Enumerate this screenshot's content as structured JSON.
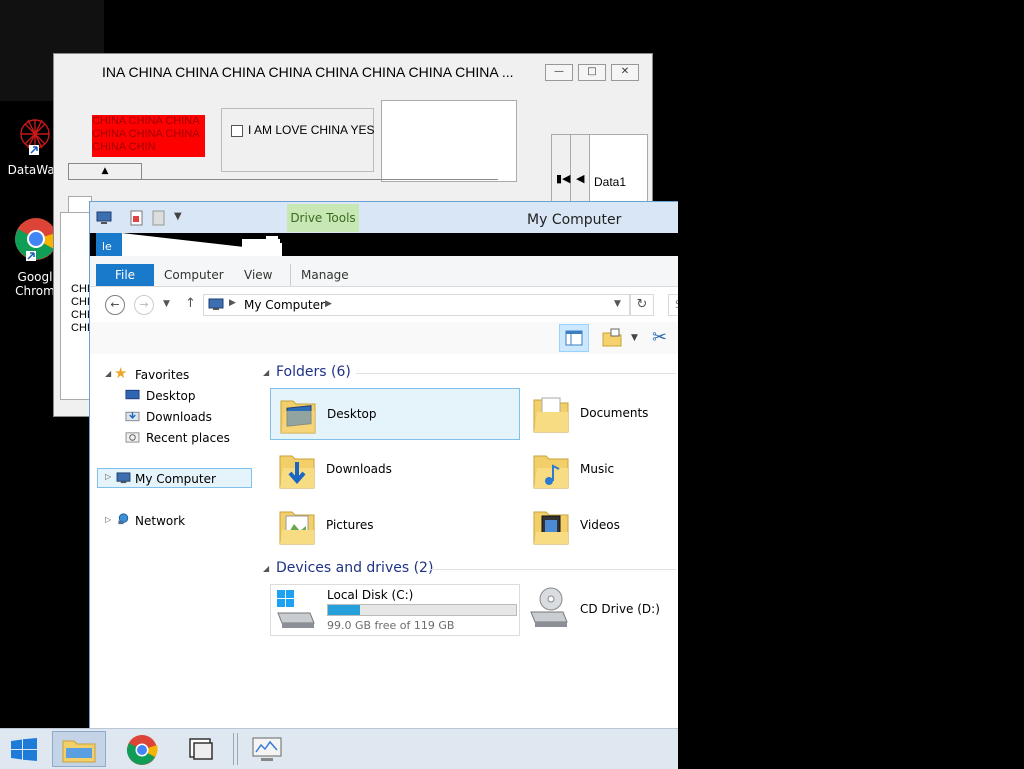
{
  "desktop": {
    "icons": [
      {
        "label": "DataWag",
        "icon": "datawag-icon"
      },
      {
        "label": "Googl Chrom",
        "icon": "chrome-icon"
      }
    ]
  },
  "dialog": {
    "title": "INA CHINA CHINA CHINA CHINA CHINA CHINA CHINA CHINA ...",
    "red_text": "CHINA CHINA CHINA CHINA CHINA CHINA CHINA CHIN",
    "checkbox_label": "I AM LOVE CHINA YES",
    "checkbox_checked": false,
    "nav_label": "Data1",
    "list_text": "CHI CHI CHI CHI",
    "colors": {
      "red": "#ff0000"
    }
  },
  "explorer": {
    "title": "My Computer",
    "context_tab": "Drive Tools",
    "ribbon_tabs": [
      "File",
      "Computer",
      "View",
      "Manage"
    ],
    "glitch_text": "le",
    "address": "My Computer",
    "search_placeholder": "S",
    "nav": {
      "favorites_label": "Favorites",
      "favorites": [
        "Desktop",
        "Downloads",
        "Recent places"
      ],
      "my_computer": "My Computer",
      "network": "Network"
    },
    "folders_header": "Folders (6)",
    "folders": [
      {
        "name": "Desktop",
        "icon": "folder-desktop-icon",
        "selected": true
      },
      {
        "name": "Documents",
        "icon": "folder-documents-icon",
        "selected": false
      },
      {
        "name": "Downloads",
        "icon": "folder-downloads-icon",
        "selected": false
      },
      {
        "name": "Music",
        "icon": "folder-music-icon",
        "selected": false
      },
      {
        "name": "Pictures",
        "icon": "folder-pictures-icon",
        "selected": false
      },
      {
        "name": "Videos",
        "icon": "folder-videos-icon",
        "selected": false
      }
    ],
    "drives_header": "Devices and drives (2)",
    "drives": [
      {
        "name": "Local Disk (C:)",
        "free": "99.0 GB free of 119 GB",
        "used_fraction": 0.168,
        "icon": "hard-disk-icon"
      },
      {
        "name": "CD Drive (D:)",
        "icon": "cd-drive-icon"
      }
    ],
    "colors": {
      "accent": "#1979ca",
      "section": "#1e3287",
      "selection": "#e5f3fb"
    }
  },
  "taskbar": {
    "items": [
      "start-icon",
      "file-explorer-icon",
      "chrome-icon",
      "folder-app-icon",
      "monitor-app-icon"
    ]
  }
}
